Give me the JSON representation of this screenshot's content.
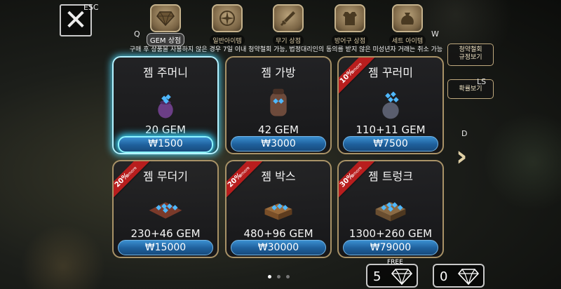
{
  "top": {
    "close_key": "ESC",
    "tab_prev_key": "Q",
    "tab_next_key": "W",
    "tabs": [
      {
        "label": "GEM 상점"
      },
      {
        "label": "일반아이템"
      },
      {
        "label": "무기 상점"
      },
      {
        "label": "방어구 상점"
      },
      {
        "label": "세트 아이템"
      }
    ]
  },
  "notice": "구매 후 상품을 사용하지 않은 경우 7일 이내 청약철회 가능, 법정대리인의 동의를 받지 않은 미성년자 거래는 취소 가능",
  "side": {
    "terms_label": "청약철회\n규정보기",
    "prob_label": "확률보기",
    "prob_key": "LS",
    "next_key": "D"
  },
  "products": [
    {
      "name": "젬 주머니",
      "amount": "20 GEM",
      "price": "₩1500",
      "ribbon": "",
      "selected": true
    },
    {
      "name": "젬 가방",
      "amount": "42 GEM",
      "price": "₩3000",
      "ribbon": ""
    },
    {
      "name": "젬 꾸러미",
      "amount": "110+11 GEM",
      "price": "₩7500",
      "ribbon": "10%"
    },
    {
      "name": "젬 무더기",
      "amount": "230+46 GEM",
      "price": "₩15000",
      "ribbon": "20%"
    },
    {
      "name": "젬 박스",
      "amount": "480+96 GEM",
      "price": "₩30000",
      "ribbon": "20%"
    },
    {
      "name": "젬 트렁크",
      "amount": "1300+260 GEM",
      "price": "₩79000",
      "ribbon": "30%"
    }
  ],
  "ribbon_suffix": "more",
  "bottom": {
    "free_label": "FREE",
    "free_count": "5",
    "paid_count": "0"
  },
  "pagination": {
    "pages": 3,
    "current": 1
  },
  "colors": {
    "accent": "#37d8ff",
    "price": "#1e5f9b",
    "ribbon": "#b81e1e",
    "border": "#a89267"
  }
}
